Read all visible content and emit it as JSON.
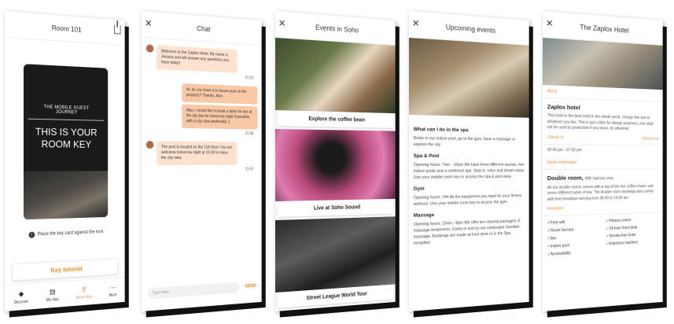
{
  "room_screen": {
    "title": "Room 101",
    "card_small": "THE MOBILE GUEST JOURNEY",
    "card_big": "THIS IS YOUR ROOM KEY",
    "hint": "Place the key card against the lock",
    "tutorial": "Key tutorial",
    "tabs": [
      {
        "label": "Discover",
        "icon": "tag-icon"
      },
      {
        "label": "My stay",
        "icon": "bed-icon"
      },
      {
        "label": "Room Key",
        "icon": "key-icon"
      },
      {
        "label": "More",
        "icon": "more-icon"
      }
    ]
  },
  "chat_screen": {
    "title": "Chat",
    "messages": [
      {
        "type": "in",
        "text": "Welcome to the Zaplox Hotel, My name is Jessica and will answer any questions you have today!",
        "time": "21:23"
      },
      {
        "type": "out",
        "text": "Hi, do you have a in-house pool on the property? Thanks, Alex",
        "time": ""
      },
      {
        "type": "out",
        "text": "Also, I would like to book a table for two at the sky bar for tomorrow night if possible, with a city view preferably :)",
        "time": "21:36"
      },
      {
        "type": "in",
        "text": "The pool is located on the 11th floor! You are welcome tomorrow night at 19:30 to enjoy the city view.",
        "time": "21:41"
      }
    ],
    "placeholder": "Type here",
    "send": "SEND"
  },
  "events_screen": {
    "title": "Events in Soho",
    "events": [
      "Explore the coffee bean",
      "Live at Soho Sound",
      "Street League World Tour"
    ]
  },
  "upcoming_screen": {
    "title": "Upcoming events",
    "heading": "What can I do in the spa",
    "intro": "Relax in our indoor pool, go to the gym, have a massage or explore the city",
    "sections": [
      {
        "title": "Spa & Pool",
        "text": "Opening hours: 7am - 10pm We have three different saunas, two indoor pools and a rainforest spa. Step in, relax and dream away. Use your mobile room key to access the spa & pool area."
      },
      {
        "title": "Gym",
        "text": "Opening hours: 24h All the equipment you need for your fitness workout. Use your mobile room key to access the gym."
      },
      {
        "title": "Massage",
        "text": "Opening hours; 10am - 8pm We offer ten relaxing packages of massage treatments. Come in and try our celebrated Swedish massage, Bookings are made at front desk or in the Spa reception."
      }
    ]
  },
  "hotel_screen": {
    "title": "The Zaplox Hotel",
    "about_label": "About",
    "hotel_name": "Zaplox hotel",
    "about_text": "This hotel is the best hotel in the whole world, change this text to whatever you like. This is just a filler for design purposes, and shall not be used in production if you know, do whatever.",
    "checkin": "Check-in",
    "checkout": "Check out",
    "hours": "02:00 pm - 07:00 pm",
    "room_info_label": "Room information",
    "room_title": "Double room,",
    "room_sub": "With balcony view",
    "room_text": "All our double rooms comes with a top of the line coffee maker and seven different types of tea. The double room bookings also comes with free breakfast serving from 06:00 to 10:00 am.",
    "amenities_label": "Amenities",
    "amenities": [
      "Free wifi",
      "Fitness centre",
      "Room Service",
      "24-hour front desk",
      "Bar",
      "Smoke-free hotel",
      "Indoor pool",
      "Espresso machine",
      "Accessibility"
    ]
  }
}
